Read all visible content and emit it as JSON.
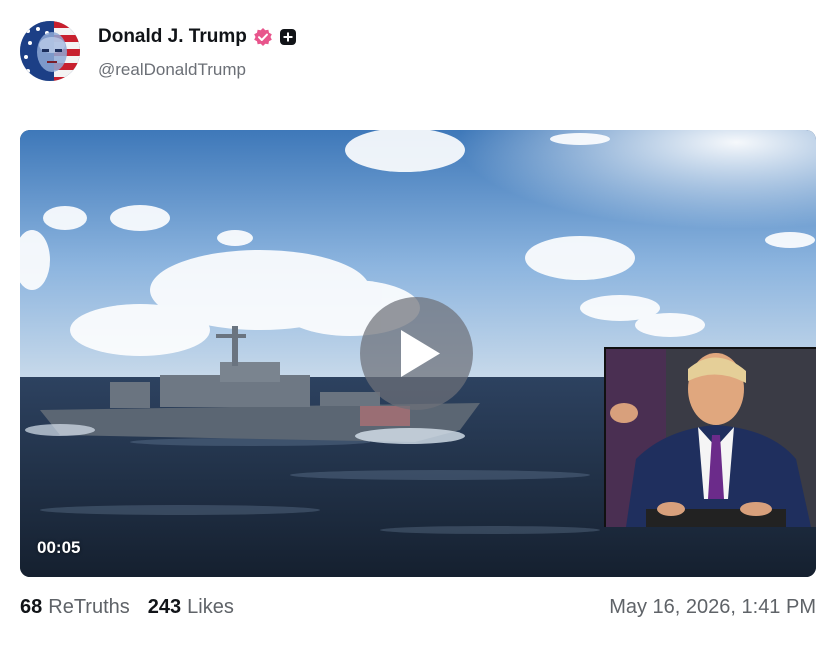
{
  "post": {
    "author": {
      "display_name": "Donald J. Trump",
      "handle": "@realDonaldTrump",
      "verified_icon": "verified-badge-icon",
      "extra_badge_icon": "plus-badge-icon",
      "verified_color": "#e8558c"
    },
    "media": {
      "type": "video",
      "duration": "00:05",
      "play_icon": "play-icon"
    },
    "stats": {
      "retruths_count": "68",
      "retruths_label": "ReTruths",
      "likes_count": "243",
      "likes_label": "Likes"
    },
    "timestamp": "May 16, 2026, 1:41 PM"
  }
}
